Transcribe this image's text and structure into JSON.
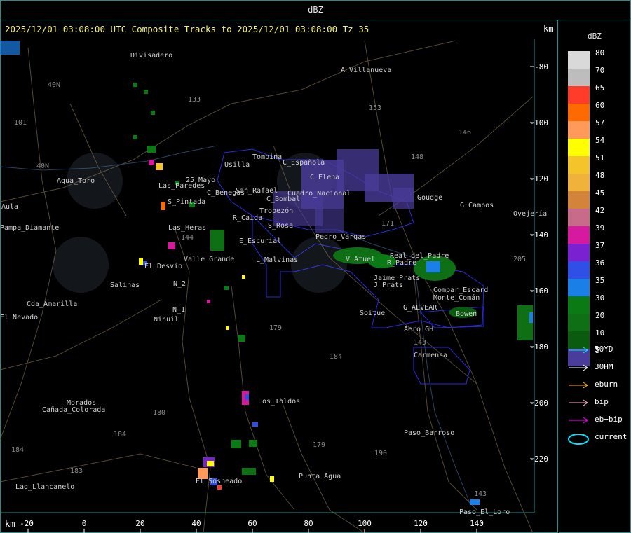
{
  "window": {
    "title": "dBZ"
  },
  "header": {
    "text": "2025/12/01 03:08:00 UTC Composite Tracks to 2025/12/01 03:08:00 Tz 35",
    "km_top": "km",
    "km_bottom": "km"
  },
  "axes": {
    "x_ticks": [
      "-20",
      "0",
      "20",
      "40",
      "60",
      "80",
      "100",
      "120",
      "140"
    ],
    "y_ticks": [
      "-80",
      "-100",
      "-120",
      "-140",
      "-160",
      "-180",
      "-200",
      "-220"
    ]
  },
  "places": [
    "Divisadero",
    "A_Villanueva",
    "Agua_Toro",
    "El_Desvio",
    "Salinas",
    "N_2",
    "N_1",
    "Nihuil",
    "Valle_Grande",
    "E_Escurial",
    "L_Malvinas",
    "S_Rosa",
    "R_Caida",
    "C_Benegas",
    "C_Bombal",
    "C_Elena",
    "C_Española",
    "Usilla",
    "Tombina",
    "Aula",
    "Pampa_Diamante",
    "Morados",
    "Lag_Llancanelo",
    "Los_Toldos",
    "Punta_Agua",
    "Paso_Barroso",
    "Paso_El_Loro",
    "Carmensa",
    "Aero_GH",
    "G_ALVEAR",
    "Bowen",
    "Soitue",
    "Compar_Escard",
    "V_Atuel",
    "R_Padre",
    "J_Prats",
    "G_Campos",
    "Goudge",
    "Cda_Amarilla",
    "El_Nevado",
    "San_Rafael",
    "Cuadro_Nacional",
    "25_Mayo",
    "S_Pintada",
    "Las_Paredes",
    "Pedro_Vargas",
    "Monte_Comán",
    "Real_del_Padre",
    "Jaime_Prats",
    "Ovejería",
    "El_Sosneado",
    "Cañada_Colorada",
    "Las_Heras",
    "Tropezón"
  ],
  "routes": [
    "101",
    "40N",
    "40N",
    "144",
    "133",
    "153",
    "146",
    "148",
    "171",
    "179",
    "184",
    "180",
    "184",
    "183",
    "184",
    "179",
    "190",
    "143",
    "143",
    "205"
  ],
  "legend": {
    "unit": "dBZ",
    "scale": [
      {
        "label": "80",
        "color": "#d9d9d9"
      },
      {
        "label": "70",
        "color": "#bdbdbd"
      },
      {
        "label": "65",
        "color": "#ff3b2a"
      },
      {
        "label": "60",
        "color": "#ff6a00"
      },
      {
        "label": "57",
        "color": "#ff9a5a"
      },
      {
        "label": "54",
        "color": "#ffff00"
      },
      {
        "label": "51",
        "color": "#f5c42a"
      },
      {
        "label": "48",
        "color": "#f0b23a"
      },
      {
        "label": "45",
        "color": "#d4843a"
      },
      {
        "label": "42",
        "color": "#c86a8a"
      },
      {
        "label": "39",
        "color": "#d61aa0"
      },
      {
        "label": "37",
        "color": "#7a22d2"
      },
      {
        "label": "36",
        "color": "#2f50e6"
      },
      {
        "label": "35",
        "color": "#1a7fe6"
      },
      {
        "label": "30",
        "color": "#0a7a14"
      },
      {
        "label": "20",
        "color": "#0f6f14"
      },
      {
        "label": "10",
        "color": "#0a5a10"
      },
      {
        "label": "5",
        "color": "#4a3c9a"
      }
    ],
    "tracks": [
      {
        "label": "50YD",
        "color": "#00e5ff"
      },
      {
        "label": "30HM",
        "color": "#ffffff"
      },
      {
        "label": "eburn",
        "color": "#ffb000"
      },
      {
        "label": "bip",
        "color": "#ffb0d0"
      },
      {
        "label": "eb+bip",
        "color": "#ff00ff"
      },
      {
        "label": "current",
        "color": "#00e5ff"
      }
    ]
  }
}
